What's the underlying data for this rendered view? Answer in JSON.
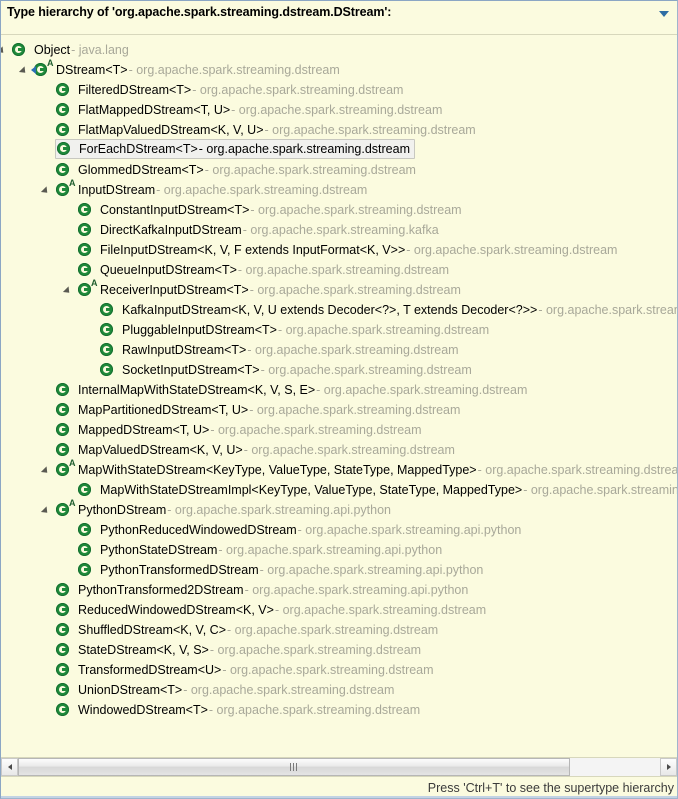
{
  "header": {
    "title": "Type hierarchy of 'org.apache.spark.streaming.dstream.DStream':",
    "view_menu_icon": "chevron-down-icon"
  },
  "colors": {
    "background": "#fbfbdf",
    "border": "#8ba6c4",
    "type_name": "#000000",
    "package_name": "#a8a899",
    "icon_green": "#1f8a3b",
    "menu_blue": "#2e6da4",
    "selection_background": "#f1f1ee"
  },
  "tree": {
    "icon_name": "class-icon",
    "abstract_badge": "A",
    "separator": "-",
    "rows": [
      {
        "depth": 0,
        "expanded": true,
        "abstract": false,
        "focus": false,
        "selected": false,
        "name": "Object",
        "pkg": "java.lang"
      },
      {
        "depth": 1,
        "expanded": true,
        "abstract": true,
        "focus": true,
        "selected": false,
        "name": "DStream<T>",
        "pkg": "org.apache.spark.streaming.dstream"
      },
      {
        "depth": 2,
        "expanded": false,
        "abstract": false,
        "focus": false,
        "selected": false,
        "name": "FilteredDStream<T>",
        "pkg": "org.apache.spark.streaming.dstream"
      },
      {
        "depth": 2,
        "expanded": false,
        "abstract": false,
        "focus": false,
        "selected": false,
        "name": "FlatMappedDStream<T, U>",
        "pkg": "org.apache.spark.streaming.dstream"
      },
      {
        "depth": 2,
        "expanded": false,
        "abstract": false,
        "focus": false,
        "selected": false,
        "name": "FlatMapValuedDStream<K, V, U>",
        "pkg": "org.apache.spark.streaming.dstream"
      },
      {
        "depth": 2,
        "expanded": false,
        "abstract": false,
        "focus": false,
        "selected": true,
        "name": "ForEachDStream<T>",
        "pkg": "org.apache.spark.streaming.dstream"
      },
      {
        "depth": 2,
        "expanded": false,
        "abstract": false,
        "focus": false,
        "selected": false,
        "name": "GlommedDStream<T>",
        "pkg": "org.apache.spark.streaming.dstream"
      },
      {
        "depth": 2,
        "expanded": true,
        "abstract": true,
        "focus": false,
        "selected": false,
        "name": "InputDStream",
        "pkg": "org.apache.spark.streaming.dstream"
      },
      {
        "depth": 3,
        "expanded": false,
        "abstract": false,
        "focus": false,
        "selected": false,
        "name": "ConstantInputDStream<T>",
        "pkg": "org.apache.spark.streaming.dstream"
      },
      {
        "depth": 3,
        "expanded": false,
        "abstract": false,
        "focus": false,
        "selected": false,
        "name": "DirectKafkaInputDStream",
        "pkg": "org.apache.spark.streaming.kafka"
      },
      {
        "depth": 3,
        "expanded": false,
        "abstract": false,
        "focus": false,
        "selected": false,
        "name": "FileInputDStream<K, V, F extends InputFormat<K, V>>",
        "pkg": "org.apache.spark.streaming.dstream"
      },
      {
        "depth": 3,
        "expanded": false,
        "abstract": false,
        "focus": false,
        "selected": false,
        "name": "QueueInputDStream<T>",
        "pkg": "org.apache.spark.streaming.dstream"
      },
      {
        "depth": 3,
        "expanded": true,
        "abstract": true,
        "focus": false,
        "selected": false,
        "name": "ReceiverInputDStream<T>",
        "pkg": "org.apache.spark.streaming.dstream"
      },
      {
        "depth": 4,
        "expanded": false,
        "abstract": false,
        "focus": false,
        "selected": false,
        "name": "KafkaInputDStream<K, V, U extends Decoder<?>, T extends Decoder<?>>",
        "pkg": "org.apache.spark.streaming.kafka"
      },
      {
        "depth": 4,
        "expanded": false,
        "abstract": false,
        "focus": false,
        "selected": false,
        "name": "PluggableInputDStream<T>",
        "pkg": "org.apache.spark.streaming.dstream"
      },
      {
        "depth": 4,
        "expanded": false,
        "abstract": false,
        "focus": false,
        "selected": false,
        "name": "RawInputDStream<T>",
        "pkg": "org.apache.spark.streaming.dstream"
      },
      {
        "depth": 4,
        "expanded": false,
        "abstract": false,
        "focus": false,
        "selected": false,
        "name": "SocketInputDStream<T>",
        "pkg": "org.apache.spark.streaming.dstream"
      },
      {
        "depth": 2,
        "expanded": false,
        "abstract": false,
        "focus": false,
        "selected": false,
        "name": "InternalMapWithStateDStream<K, V, S, E>",
        "pkg": "org.apache.spark.streaming.dstream"
      },
      {
        "depth": 2,
        "expanded": false,
        "abstract": false,
        "focus": false,
        "selected": false,
        "name": "MapPartitionedDStream<T, U>",
        "pkg": "org.apache.spark.streaming.dstream"
      },
      {
        "depth": 2,
        "expanded": false,
        "abstract": false,
        "focus": false,
        "selected": false,
        "name": "MappedDStream<T, U>",
        "pkg": "org.apache.spark.streaming.dstream"
      },
      {
        "depth": 2,
        "expanded": false,
        "abstract": false,
        "focus": false,
        "selected": false,
        "name": "MapValuedDStream<K, V, U>",
        "pkg": "org.apache.spark.streaming.dstream"
      },
      {
        "depth": 2,
        "expanded": true,
        "abstract": true,
        "focus": false,
        "selected": false,
        "name": "MapWithStateDStream<KeyType, ValueType, StateType, MappedType>",
        "pkg": "org.apache.spark.streaming.dstream"
      },
      {
        "depth": 3,
        "expanded": false,
        "abstract": false,
        "focus": false,
        "selected": false,
        "name": "MapWithStateDStreamImpl<KeyType, ValueType, StateType, MappedType>",
        "pkg": "org.apache.spark.streaming.dstream"
      },
      {
        "depth": 2,
        "expanded": true,
        "abstract": true,
        "focus": false,
        "selected": false,
        "name": "PythonDStream",
        "pkg": "org.apache.spark.streaming.api.python"
      },
      {
        "depth": 3,
        "expanded": false,
        "abstract": false,
        "focus": false,
        "selected": false,
        "name": "PythonReducedWindowedDStream",
        "pkg": "org.apache.spark.streaming.api.python"
      },
      {
        "depth": 3,
        "expanded": false,
        "abstract": false,
        "focus": false,
        "selected": false,
        "name": "PythonStateDStream",
        "pkg": "org.apache.spark.streaming.api.python"
      },
      {
        "depth": 3,
        "expanded": false,
        "abstract": false,
        "focus": false,
        "selected": false,
        "name": "PythonTransformedDStream",
        "pkg": "org.apache.spark.streaming.api.python"
      },
      {
        "depth": 2,
        "expanded": false,
        "abstract": false,
        "focus": false,
        "selected": false,
        "name": "PythonTransformed2DStream",
        "pkg": "org.apache.spark.streaming.api.python"
      },
      {
        "depth": 2,
        "expanded": false,
        "abstract": false,
        "focus": false,
        "selected": false,
        "name": "ReducedWindowedDStream<K, V>",
        "pkg": "org.apache.spark.streaming.dstream"
      },
      {
        "depth": 2,
        "expanded": false,
        "abstract": false,
        "focus": false,
        "selected": false,
        "name": "ShuffledDStream<K, V, C>",
        "pkg": "org.apache.spark.streaming.dstream"
      },
      {
        "depth": 2,
        "expanded": false,
        "abstract": false,
        "focus": false,
        "selected": false,
        "name": "StateDStream<K, V, S>",
        "pkg": "org.apache.spark.streaming.dstream"
      },
      {
        "depth": 2,
        "expanded": false,
        "abstract": false,
        "focus": false,
        "selected": false,
        "name": "TransformedDStream<U>",
        "pkg": "org.apache.spark.streaming.dstream"
      },
      {
        "depth": 2,
        "expanded": false,
        "abstract": false,
        "focus": false,
        "selected": false,
        "name": "UnionDStream<T>",
        "pkg": "org.apache.spark.streaming.dstream"
      },
      {
        "depth": 2,
        "expanded": false,
        "abstract": false,
        "focus": false,
        "selected": false,
        "name": "WindowedDStream<T>",
        "pkg": "org.apache.spark.streaming.dstream"
      }
    ]
  },
  "scrollbar": {
    "left_arrow_icon": "arrow-left-icon",
    "right_arrow_icon": "arrow-right-icon",
    "thumb_grip_icon": "grip-icon"
  },
  "statusbar": {
    "message": "Press 'Ctrl+T' to see the supertype hierarchy"
  }
}
